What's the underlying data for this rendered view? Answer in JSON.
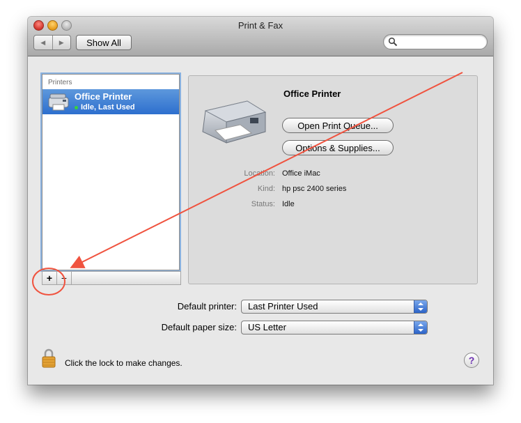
{
  "window": {
    "title": "Print & Fax"
  },
  "toolbar": {
    "back_glyph": "◀",
    "forward_glyph": "▶",
    "show_all_label": "Show All",
    "search_placeholder": ""
  },
  "printers": {
    "header": "Printers",
    "items": [
      {
        "name": "Office Printer",
        "status": "Idle, Last Used"
      }
    ]
  },
  "list_buttons": {
    "add": "+",
    "remove": "−"
  },
  "detail": {
    "title": "Office Printer",
    "open_queue_label": "Open Print Queue...",
    "options_label": "Options & Supplies...",
    "fields": [
      {
        "label": "Location:",
        "value": "Office iMac"
      },
      {
        "label": "Kind:",
        "value": "hp psc 2400 series"
      },
      {
        "label": "Status:",
        "value": "Idle"
      }
    ]
  },
  "defaults": {
    "printer_label": "Default printer:",
    "printer_value": "Last Printer Used",
    "paper_label": "Default paper size:",
    "paper_value": "US Letter"
  },
  "lock": {
    "text": "Click the lock to make changes."
  },
  "help": {
    "glyph": "?"
  },
  "annotation": {
    "color": "#f0533f"
  }
}
